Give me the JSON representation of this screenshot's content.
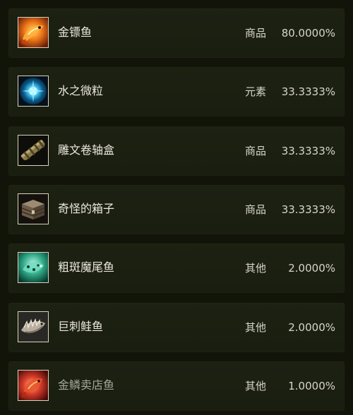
{
  "items": [
    {
      "name": "金镖鱼",
      "category": "商品",
      "probability": "80.0000%",
      "icon": "golden-dart-fish-icon"
    },
    {
      "name": "水之微粒",
      "category": "元素",
      "probability": "33.3333%",
      "icon": "water-mote-icon"
    },
    {
      "name": "雕文卷轴盒",
      "category": "商品",
      "probability": "33.3333%",
      "icon": "scroll-case-icon"
    },
    {
      "name": "奇怪的箱子",
      "category": "商品",
      "probability": "33.3333%",
      "icon": "strange-chest-icon"
    },
    {
      "name": "粗斑魔尾鱼",
      "category": "其他",
      "probability": "2.0000%",
      "icon": "spotted-fish-icon"
    },
    {
      "name": "巨刺鲑鱼",
      "category": "其他",
      "probability": "2.0000%",
      "icon": "spiny-salmon-icon"
    },
    {
      "name": "金鳞卖店鱼",
      "category": "其他",
      "probability": "1.0000%",
      "icon": "goldscale-fish-icon"
    }
  ],
  "colors": {
    "background": "#121409",
    "row": "#1b1f11",
    "text": "#ebe8de",
    "dim_text": "#a7a69d",
    "icon_border": "#d9d2bd"
  }
}
